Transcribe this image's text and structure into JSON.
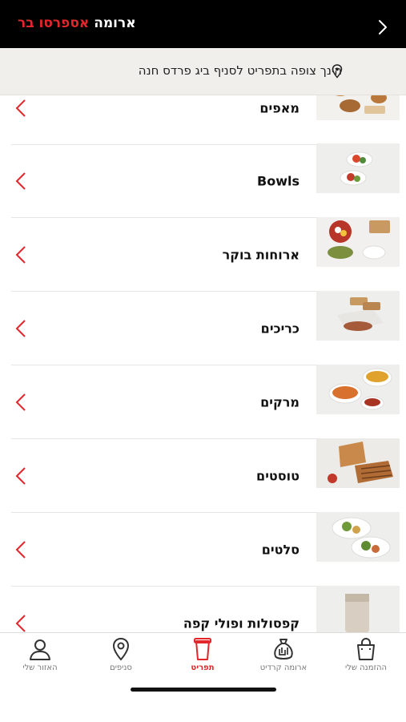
{
  "header": {
    "brand_white": "ארומה",
    "brand_red": "אספרסו בר",
    "back_icon": "chevron-right-icon"
  },
  "branch_bar": {
    "text": "הינך צופה בתפריט לסניף ביג פרדס חנה",
    "icon": "map-pin-icon"
  },
  "categories": [
    {
      "label": "מאפים"
    },
    {
      "label": "Bowls"
    },
    {
      "label": "ארוחות בוקר"
    },
    {
      "label": "כריכים"
    },
    {
      "label": "מרקים"
    },
    {
      "label": "טוסטים"
    },
    {
      "label": "סלטים"
    },
    {
      "label": "קפסולות ופולי קפה"
    }
  ],
  "tabbar": {
    "tabs": [
      {
        "label": "ההזמנה שלי",
        "icon": "shopping-bag-icon"
      },
      {
        "label": "ארומה קרדיט",
        "icon": "money-bag-icon"
      },
      {
        "label": "תפריט",
        "icon": "coffee-cup-icon",
        "active": true
      },
      {
        "label": "סניפים",
        "icon": "location-pin-icon"
      },
      {
        "label": "האזור שלי",
        "icon": "user-icon"
      }
    ]
  },
  "colors": {
    "accent": "#e3262b",
    "header_bg": "#000000",
    "branch_bg": "#f0efeb"
  }
}
